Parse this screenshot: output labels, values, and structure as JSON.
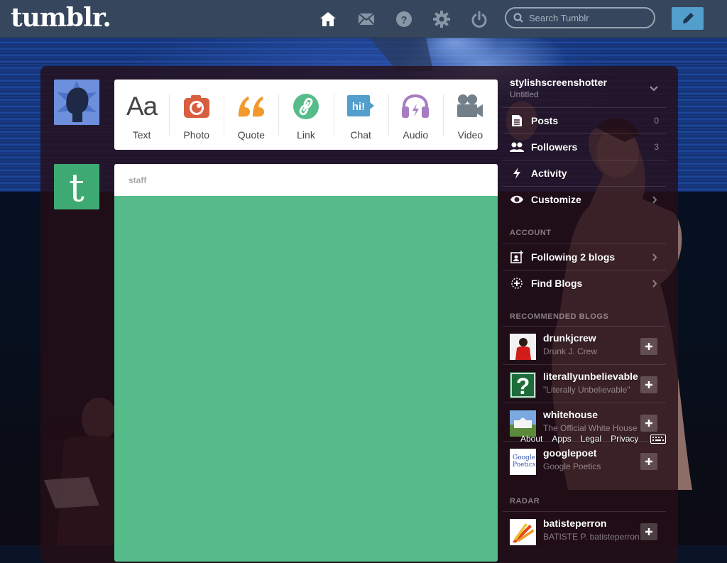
{
  "app": {
    "logo": "tumblr.",
    "search_placeholder": "Search Tumblr"
  },
  "nav": {
    "icons": [
      "home-icon",
      "mail-icon",
      "help-icon",
      "gear-icon",
      "power-icon"
    ],
    "compose_icon": "pencil-icon"
  },
  "post_types": [
    {
      "label": "Text",
      "icon": "text-icon",
      "color": "#444444"
    },
    {
      "label": "Photo",
      "icon": "camera-icon",
      "color": "#d95e40"
    },
    {
      "label": "Quote",
      "icon": "quote-icon",
      "color": "#f2992e"
    },
    {
      "label": "Link",
      "icon": "link-icon",
      "color": "#56bc8a"
    },
    {
      "label": "Chat",
      "icon": "chat-icon",
      "color": "#529ecc"
    },
    {
      "label": "Audio",
      "icon": "headphones-icon",
      "color": "#a77dc2"
    },
    {
      "label": "Video",
      "icon": "video-camera-icon",
      "color": "#748089"
    }
  ],
  "post": {
    "author": "staff",
    "background": "#56bc8a"
  },
  "sidebar": {
    "blog_name": "stylishscreenshotter",
    "blog_title": "Untitled",
    "items": [
      {
        "label": "Posts",
        "count": "0",
        "icon": "posts-icon"
      },
      {
        "label": "Followers",
        "count": "3",
        "icon": "followers-icon"
      },
      {
        "label": "Activity",
        "count": "",
        "icon": "activity-icon"
      },
      {
        "label": "Customize",
        "count": "",
        "icon": "eye-icon"
      }
    ],
    "account_heading": "ACCOUNT",
    "account_items": [
      {
        "label": "Following 2 blogs",
        "icon": "following-icon"
      },
      {
        "label": "Find Blogs",
        "icon": "find-blogs-icon"
      }
    ],
    "recommended_heading": "RECOMMENDED BLOGS",
    "recommended": [
      {
        "name": "drunkjcrew",
        "subtitle": "Drunk J. Crew"
      },
      {
        "name": "literallyunbelievable",
        "subtitle": "\"Literally Unbelievable\""
      },
      {
        "name": "whitehouse",
        "subtitle": "The Official White House"
      },
      {
        "name": "googlepoet",
        "subtitle": "Google Poetics",
        "thumb_text": "Google Poetics"
      }
    ],
    "radar_heading": "RADAR",
    "radar": [
      {
        "name": "batisteperron",
        "subtitle": "BATISTE P. batisteperron"
      }
    ]
  },
  "footer": {
    "links": [
      "About",
      "Apps",
      "Legal",
      "Privacy"
    ]
  }
}
